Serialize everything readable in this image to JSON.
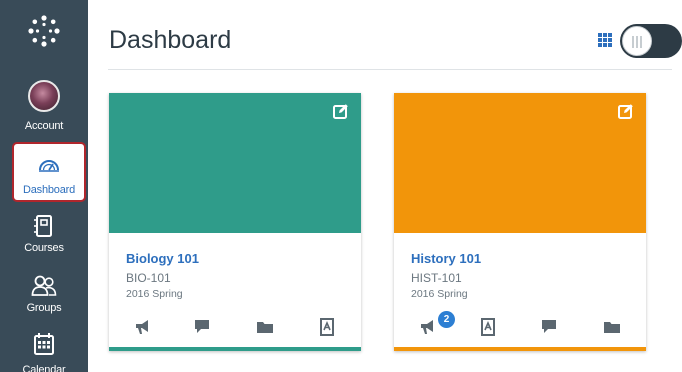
{
  "nav": {
    "items": [
      {
        "label": "Account",
        "icon": "avatar"
      },
      {
        "label": "Dashboard",
        "icon": "dashboard-icon"
      },
      {
        "label": "Courses",
        "icon": "courses-icon"
      },
      {
        "label": "Groups",
        "icon": "groups-icon"
      },
      {
        "label": "Calendar",
        "icon": "calendar-icon"
      }
    ],
    "active_item": "Dashboard",
    "colors": {
      "background": "#394b58",
      "active_border": "#b0262c",
      "active_text": "#2d6fbd"
    }
  },
  "header": {
    "title": "Dashboard",
    "view_toggle": {
      "icon": "grid-icon",
      "state": "card-view"
    }
  },
  "cards": [
    {
      "title": "Biology 101",
      "code": "BIO-101",
      "term": "2016 Spring",
      "color": "#2f9c8a",
      "actions": [
        {
          "icon": "announcements-icon"
        },
        {
          "icon": "discussions-icon"
        },
        {
          "icon": "files-icon"
        },
        {
          "icon": "assignments-icon"
        }
      ]
    },
    {
      "title": "History 101",
      "code": "HIST-101",
      "term": "2016 Spring",
      "color": "#f2950a",
      "actions": [
        {
          "icon": "announcements-icon",
          "badge": "2"
        },
        {
          "icon": "assignments-icon"
        },
        {
          "icon": "discussions-icon"
        },
        {
          "icon": "files-icon"
        }
      ]
    }
  ]
}
